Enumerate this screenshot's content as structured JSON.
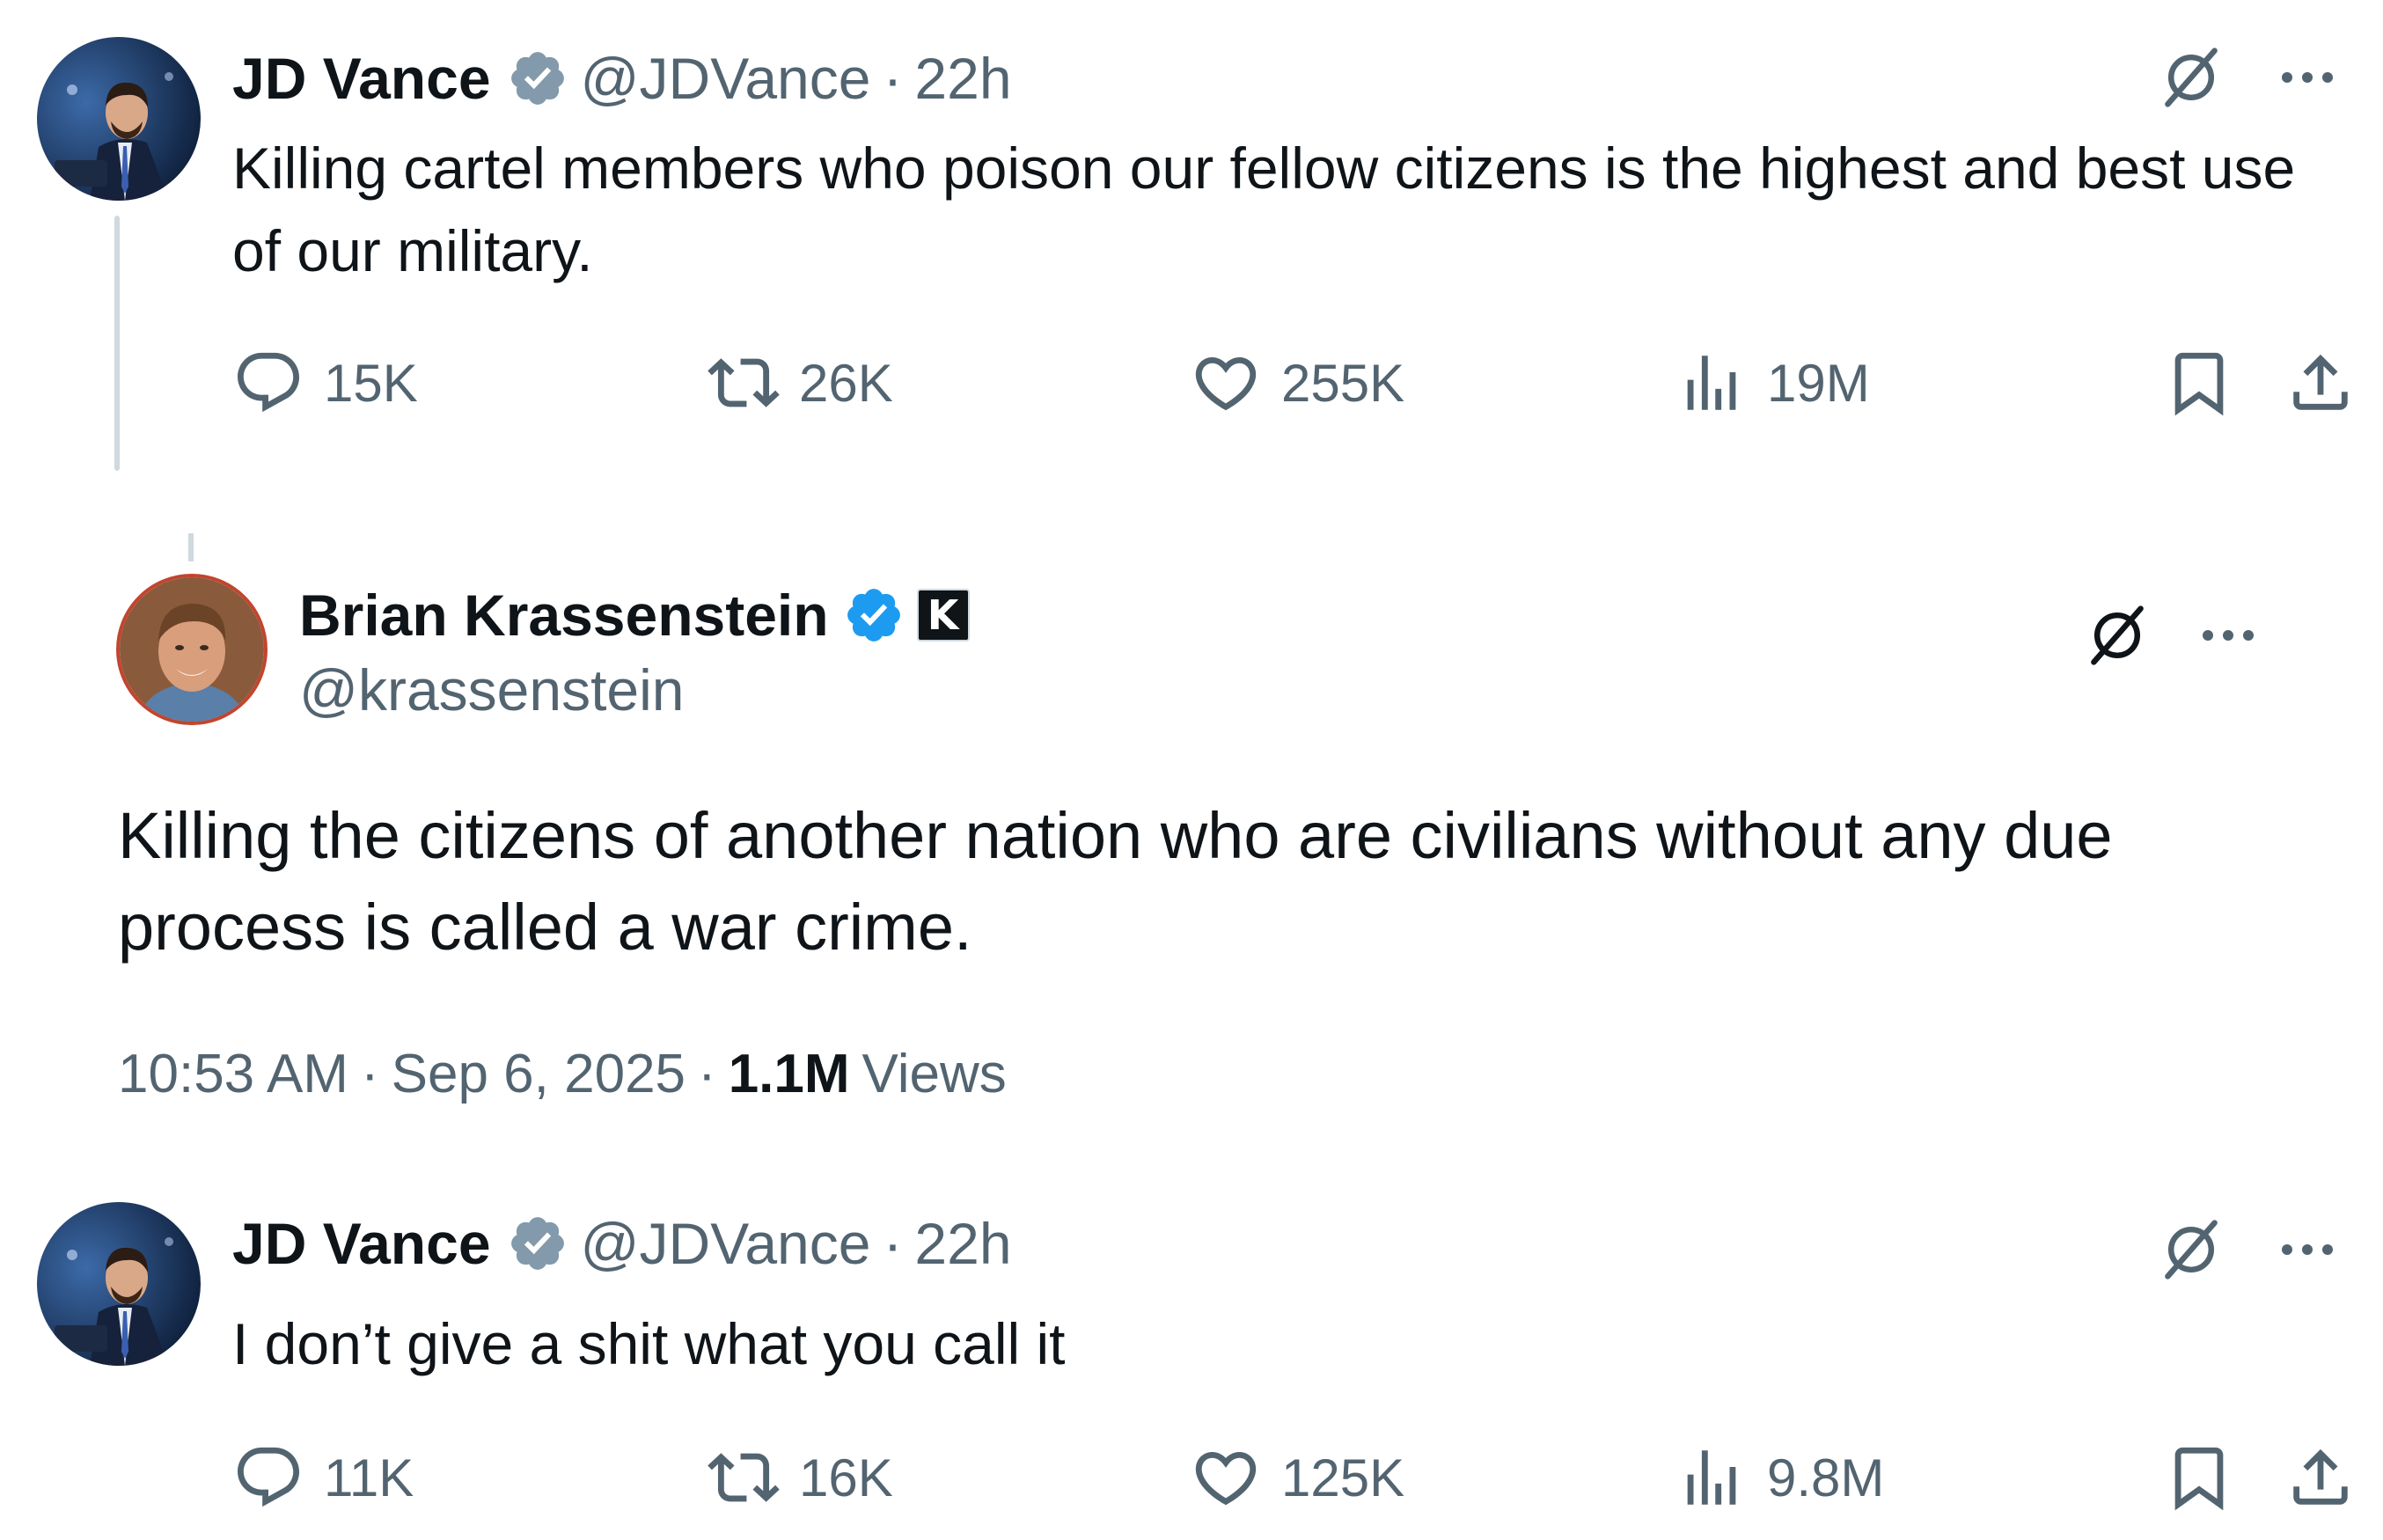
{
  "tweets": [
    {
      "author_name": "JD Vance",
      "handle": "@JDVance",
      "separator": "·",
      "time": "22h",
      "text": "Killing cartel members who poison our fellow citizens is the highest and best use of our military.",
      "replies": "15K",
      "reposts": "26K",
      "likes": "255K",
      "views": "19M"
    },
    {
      "author_name": "Brian Krassenstein",
      "handle": "@krassenstein",
      "text": "Killing the citizens of another nation who are civilians without any due process is called a war crime.",
      "time": "10:53 AM",
      "separator": "·",
      "date": "Sep 6, 2025",
      "views_count": "1.1M",
      "views_label": "Views"
    },
    {
      "author_name": "JD Vance",
      "handle": "@JDVance",
      "separator": "·",
      "time": "22h",
      "text": "I don’t give a shit what you call it",
      "replies": "11K",
      "reposts": "16K",
      "likes": "125K",
      "views": "9.8M"
    }
  ],
  "badge_letter": "K",
  "colors": {
    "text": "#0f1419",
    "muted": "#536471",
    "verified_gray": "#829aab",
    "verified_blue": "#1d9bf0",
    "thread_line": "#cfd9de"
  },
  "icons": [
    "verified-badge-icon",
    "grok-icon",
    "more-icon",
    "reply-icon",
    "repost-icon",
    "like-icon",
    "views-icon",
    "bookmark-icon",
    "share-icon"
  ]
}
